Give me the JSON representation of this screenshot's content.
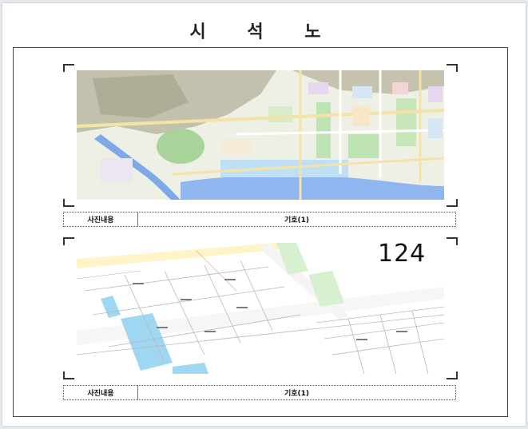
{
  "document": {
    "title": "시 석 노"
  },
  "photos": [
    {
      "caption_label": "사진내용",
      "caption_value": "기호(1)",
      "content": "map"
    },
    {
      "caption_label": "사진내용",
      "caption_value": "기호(1)",
      "content": "cadastral",
      "big_number": "124"
    }
  ],
  "colors": {
    "water": "#8fb6ef",
    "park": "#a8d39a",
    "mountain": "#b9b9a3",
    "road": "#f4e2a8",
    "paper": "#ffffff"
  }
}
